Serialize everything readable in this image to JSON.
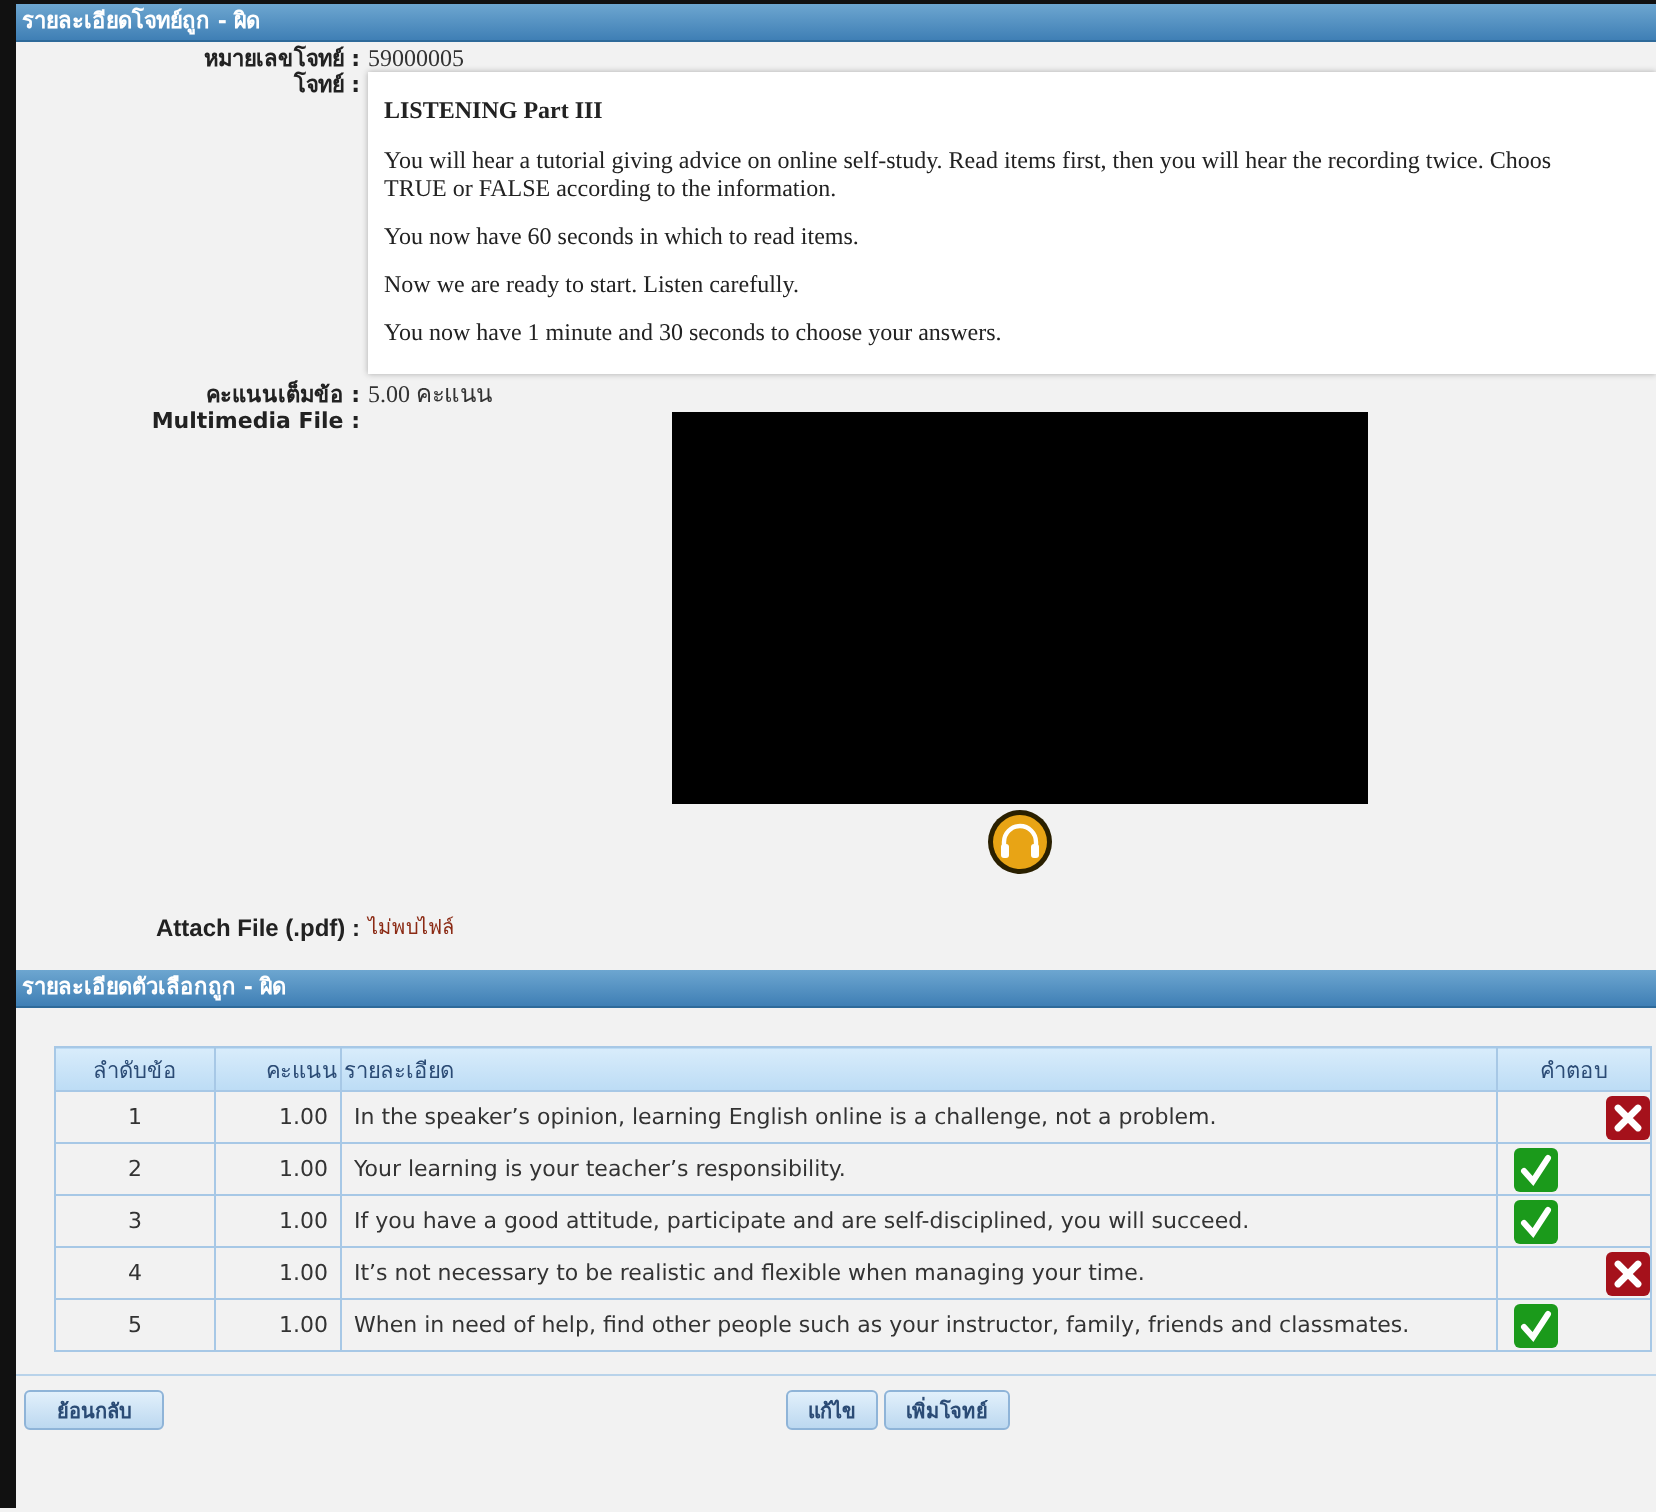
{
  "question_panel": {
    "title": "รายละเอียดโจทย์ถูก - ผิด",
    "fields": [
      {
        "label": "หมายเลขโจทย์ :",
        "value": "59000005"
      }
    ],
    "question_label": "โจทย์ :",
    "question": {
      "heading": "LISTENING Part III",
      "paragraphs": [
        [
          "You will hear a tutorial giving advice on online self-study.  Read items first, then you will hear the recording twice. Choos",
          "TRUE or FALSE according to the information."
        ],
        [
          "You now have 60 seconds in which to read items."
        ],
        [
          "Now we are ready to start.  Listen carefully."
        ],
        [
          "You now have 1 minute and 30 seconds to choose your answers."
        ]
      ]
    },
    "score": {
      "label": "คะแนนเต็มข้อ :",
      "value": "5.00  คะแนน"
    },
    "multimedia_label": "Multimedia File :",
    "attach": {
      "label": "Attach File (.pdf) :",
      "value": "ไม่พบไฟล์"
    }
  },
  "choices_panel": {
    "title": "รายละเอียดตัวเลือกถูก - ผิด",
    "table": {
      "columns": [
        "ลำดับข้อ",
        "คะแนน",
        "รายละเอียด",
        "คำตอบ"
      ],
      "rows": [
        {
          "number": "1",
          "score": "1.00",
          "detail": "In the speaker’s opinion, learning English online is a challenge, not a problem.",
          "answer": false
        },
        {
          "number": "2",
          "score": "1.00",
          "detail": "Your learning is your teacher’s responsibility.",
          "answer": true
        },
        {
          "number": "3",
          "score": "1.00",
          "detail": "If you have a good attitude, participate and are self-disciplined, you will succeed.",
          "answer": true
        },
        {
          "number": "4",
          "score": "1.00",
          "detail": "It’s not necessary to be realistic and flexible when managing your time.",
          "answer": false
        },
        {
          "number": "5",
          "score": "1.00",
          "detail": "When in need of help, find other people such as your instructor, family, friends and classmates.",
          "answer": true
        }
      ]
    }
  },
  "footer": {
    "back_button": "ย้อนกลับ",
    "buttons": [
      "แก้ไข",
      "เพิ่มโจทย์"
    ]
  }
}
